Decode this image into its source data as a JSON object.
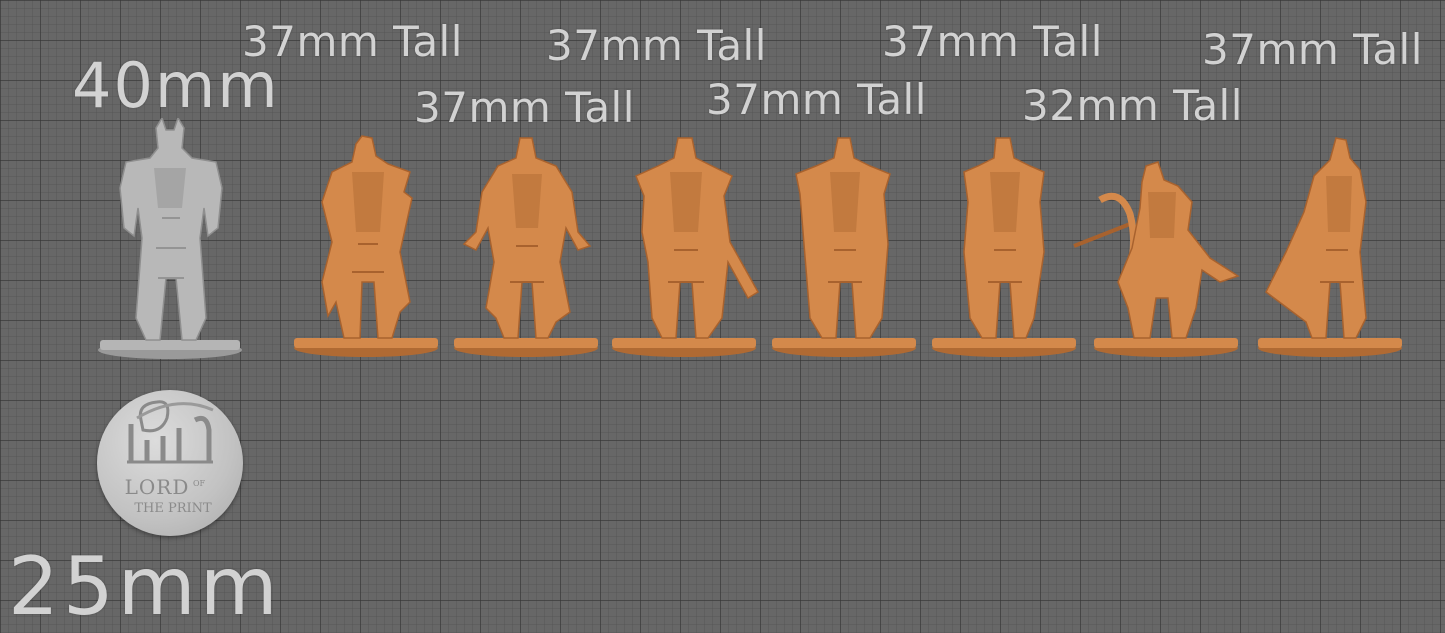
{
  "labels": {
    "reference_height": "40mm",
    "base_size": "25mm",
    "heights": [
      "37mm Tall",
      "37mm Tall",
      "37mm Tall",
      "37mm Tall",
      "37mm Tall",
      "32mm Tall",
      "37mm Tall"
    ]
  },
  "logo": {
    "text_line1": "LORD",
    "text_of": "OF",
    "text_line2": "THE PRINT"
  },
  "colors": {
    "figure": "#d4894b",
    "reference_figure": "#b8b8b8",
    "background": "#676767",
    "text": "#d2d2d2"
  }
}
